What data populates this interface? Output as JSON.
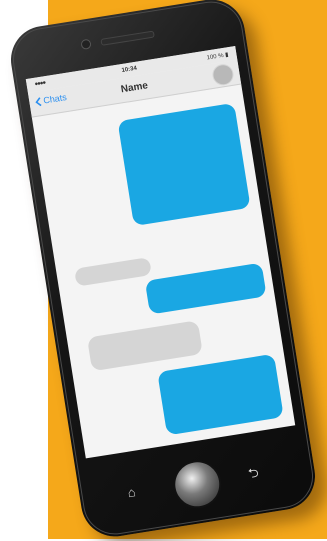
{
  "status_bar": {
    "signal": "●●●● ",
    "time": "10:34",
    "battery": "100 % ▮"
  },
  "nav": {
    "back_label": "Chats",
    "contact_name": "Name"
  },
  "icons": {
    "back": "chevron-left-icon",
    "home_key": "home-icon",
    "return_key": "return-icon"
  },
  "colors": {
    "background": "#f5a81a",
    "outgoing_bubble": "#1aa7e3",
    "incoming_bubble": "#d5d5d5",
    "back_link": "#2a8ff0"
  }
}
